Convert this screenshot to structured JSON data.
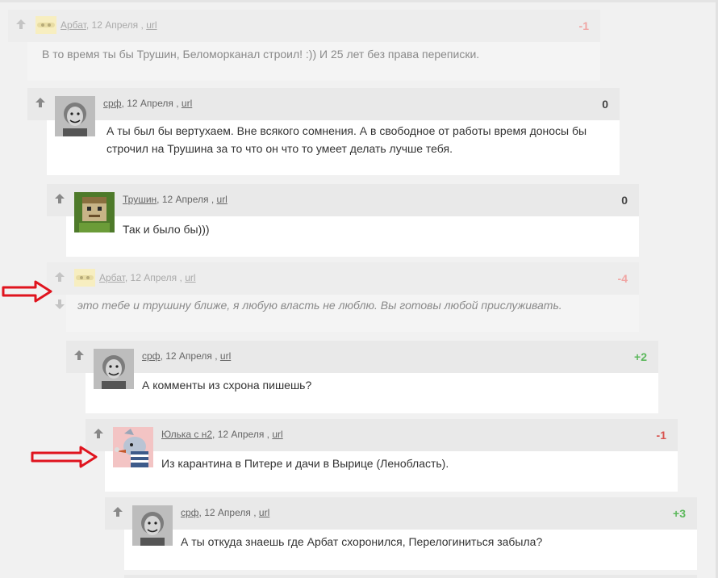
{
  "comments": [
    {
      "author": "Арбат",
      "date": "12 Апреля",
      "sep": ",",
      "link": "url",
      "score": "-1",
      "text": "В то время ты бы Трушин, Беломорканал строил! :)) И 25 лет без права переписки."
    },
    {
      "author": "срф",
      "date": "12 Апреля",
      "sep": ",",
      "link": "url",
      "score": "0",
      "text": " А ты был бы вертухаем. Вне всякого сомнения. А в свободное от работы время доносы бы строчил на Трушина за то что он что то умеет делать лучше тебя."
    },
    {
      "author": "Трушин",
      "date": "12 Апреля",
      "sep": ",",
      "link": "url",
      "score": "0",
      "text": "Так и было бы)))"
    },
    {
      "author": "Арбат",
      "date": "12 Апреля",
      "sep": ",",
      "link": "url",
      "score": "-4",
      "text": "это тебе и трушину ближе, я любую власть не люблю. Вы готовы любой прислуживать."
    },
    {
      "author": "срф",
      "date": "12 Апреля",
      "sep": ",",
      "link": "url",
      "score": "+2",
      "text": "А комменты из схрона пишешь?"
    },
    {
      "author": "Юлька с н2",
      "date": "12 Апреля",
      "sep": ",",
      "link": "url",
      "score": "-1",
      "text": "Из карантина в Питере и дачи в Вырице (Ленобласть)."
    },
    {
      "author": "срф",
      "date": "12 Апреля",
      "sep": ",",
      "link": "url",
      "score": "+3",
      "text": "А ты откуда знаешь где Арбат схоронился, Перелогиниться забыла?"
    }
  ],
  "colors": {
    "negative": "#d9534f",
    "negative_faded": "#f0a6a4",
    "positive": "#5cb85c",
    "neutral": "#444444",
    "annotation_arrow": "#e0141e"
  }
}
